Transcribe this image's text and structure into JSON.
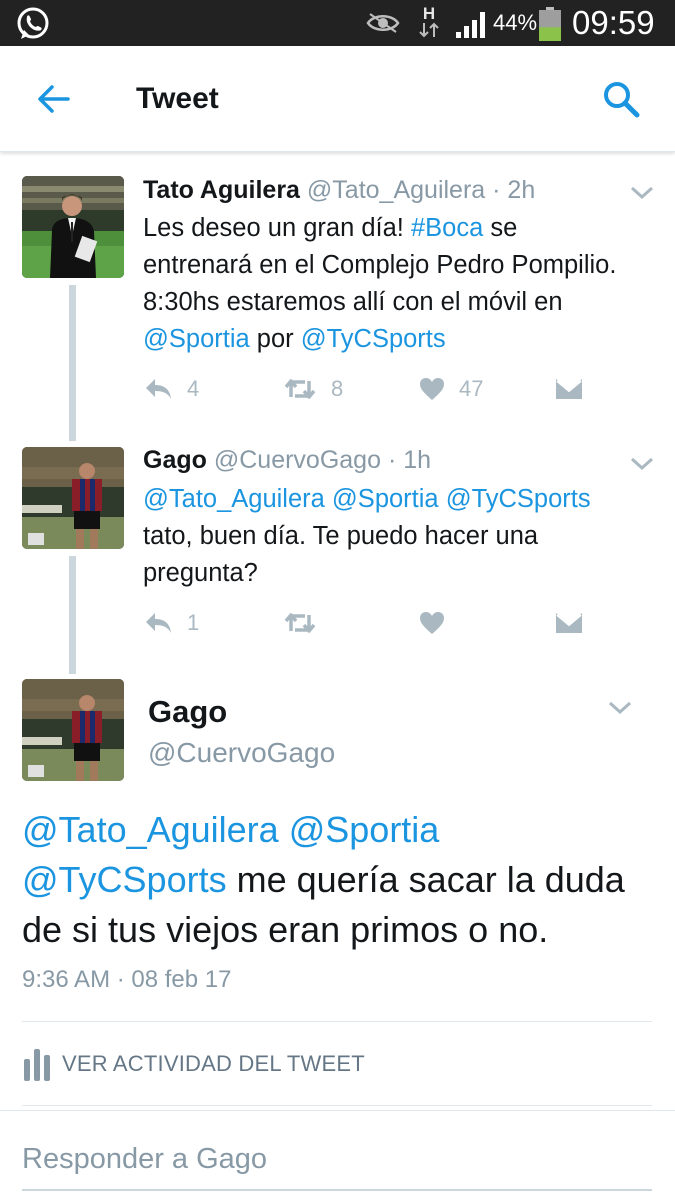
{
  "status_bar": {
    "icons": [
      "whatsapp-icon",
      "eye-icon",
      "hspa-signal-icon",
      "cell-signal-icon",
      "battery-icon"
    ],
    "network_label": "H",
    "battery_percent": "44%",
    "battery_level": 0.44,
    "time": "09:59"
  },
  "header": {
    "title": "Tweet",
    "back_icon": "arrow-left-icon",
    "search_icon": "search-icon"
  },
  "thread": [
    {
      "name": "Tato Aguilera",
      "handle": "@Tato_Aguilera",
      "time": "· 2h",
      "body_line1_text": "Les deseo un gran día! ",
      "body_line1_tag": "#Boca",
      "body_line1_rest": " se",
      "body_line2": "entrenará en el Complejo Pedro Pompilio.",
      "body_line3": "8:30hs estaremos allí  con el móvil en",
      "body_mention1": "@Sportia",
      "body_mid": " por ",
      "body_mention2": "@TyCSports",
      "reply_count": "4",
      "retweet_count": "8",
      "like_count": "47"
    },
    {
      "name": "Gago",
      "handle": "@CuervoGago",
      "time": "· 1h",
      "mention1": "@Tato_Aguilera",
      "mention2": "@Sportia",
      "mention3": "@TyCSports",
      "body_line2": "tato, buen día. Te puedo hacer una",
      "body_line3": "pregunta?",
      "reply_count": "1"
    }
  ],
  "focused_tweet": {
    "name": "Gago",
    "handle": "@CuervoGago",
    "mention1": "@Tato_Aguilera",
    "mention2": "@Sportia",
    "mention3": "@TyCSports",
    "body_rest1": " me quería sacar la duda",
    "body_line3": "de si tus viejos eran primos o no.",
    "timestamp": "9:36 AM · 08 feb 17",
    "activity_label": "VER ACTIVIDAD DEL TWEET"
  },
  "reply": {
    "placeholder": "Responder a Gago"
  },
  "colors": {
    "link": "#1b95e0",
    "status_bar": "#222222",
    "icon_gray": "#aab8c2",
    "battery_green": "#8bc34a"
  }
}
